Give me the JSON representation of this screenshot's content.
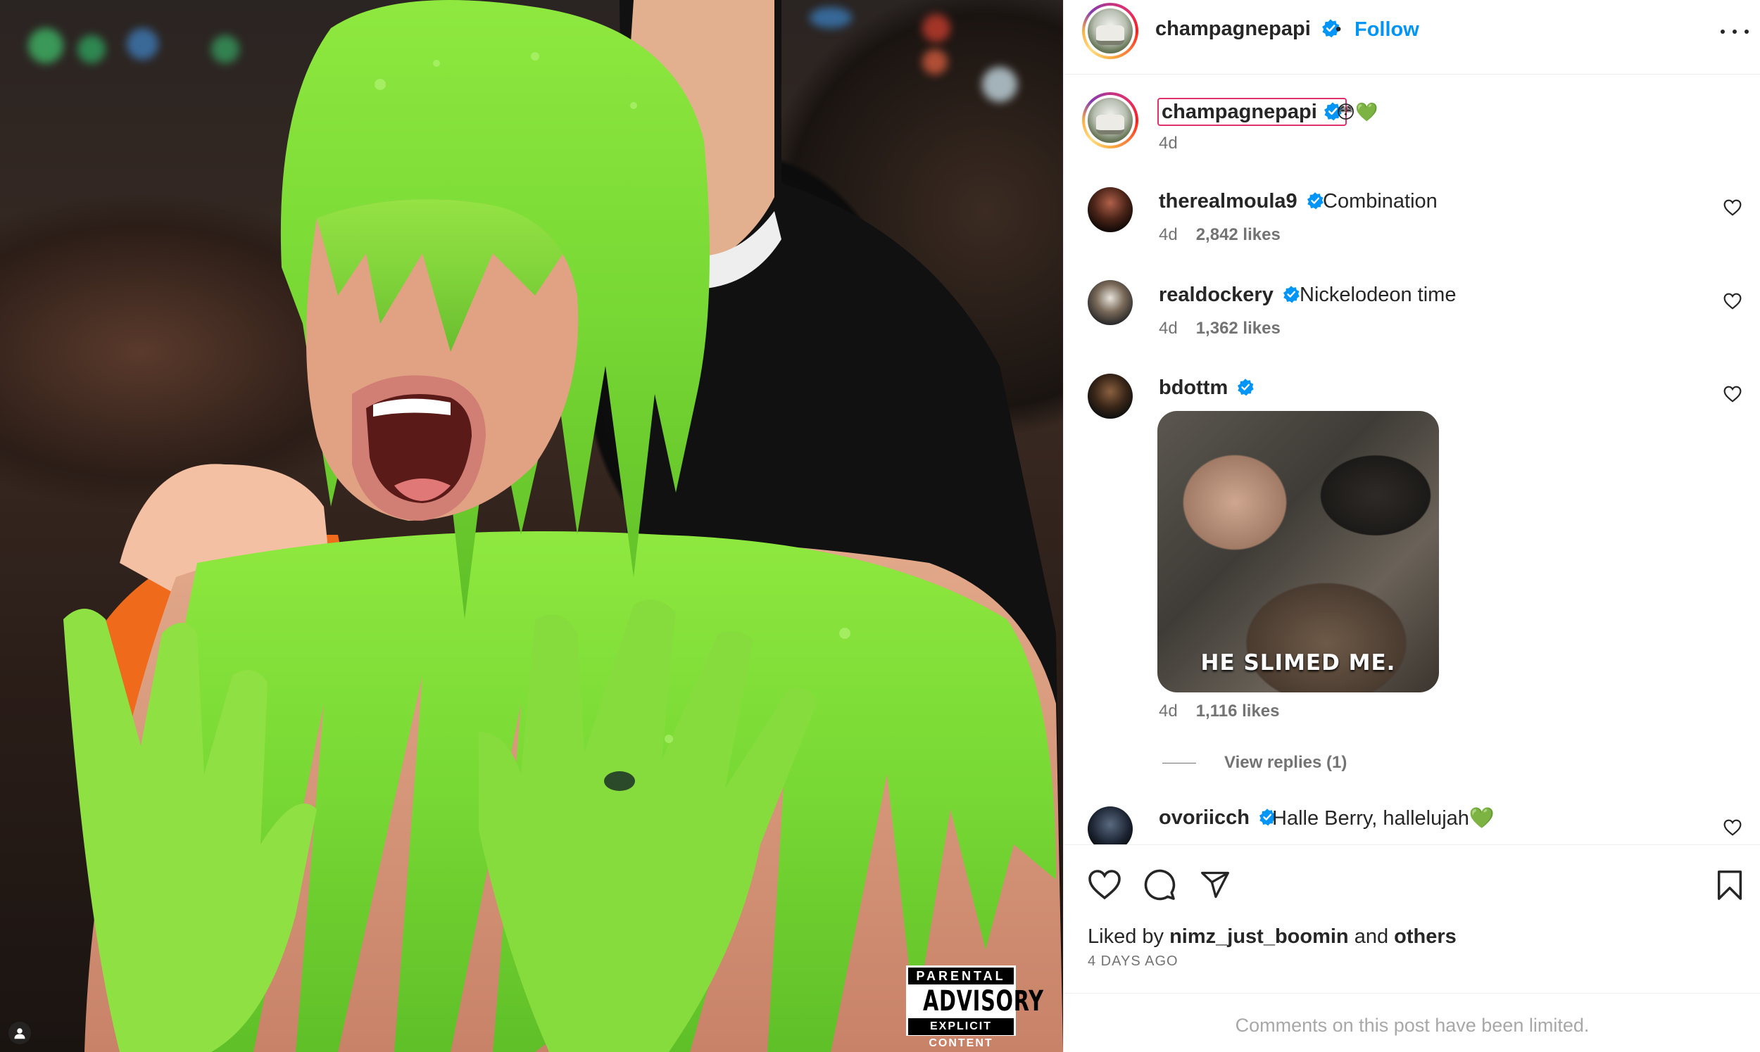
{
  "post": {
    "image_alt": "slimed woman photo",
    "advisory": {
      "top": "PARENTAL",
      "middle": "ADVISORY",
      "bottom": "EXPLICIT CONTENT"
    }
  },
  "header": {
    "username": "champagnepapi",
    "separator": "•",
    "follow_label": "Follow"
  },
  "caption": {
    "username": "champagnepapi",
    "emojis": "😳💚",
    "time": "4d"
  },
  "comments": [
    {
      "username": "therealmoula9",
      "text": "Combination",
      "time": "4d",
      "likes": "2,842 likes"
    },
    {
      "username": "realdockery",
      "text": "Nickelodeon time",
      "time": "4d",
      "likes": "1,362 likes"
    },
    {
      "username": "bdottm",
      "text": "",
      "gif_text": "HE SLIMED ME.",
      "time": "4d",
      "likes": "1,116 likes",
      "view_replies": "View replies (1)"
    },
    {
      "username": "ovoriicch",
      "text": "Halle Berry, hallelujah💚"
    }
  ],
  "footer": {
    "liked_prefix": "Liked by ",
    "liked_user": "nimz_just_boomin",
    "liked_mid": " and ",
    "liked_others": "others",
    "date": "4 DAYS AGO",
    "limited": "Comments on this post have been limited."
  },
  "colors": {
    "accent": "#0095f6",
    "verified": "#0095f6",
    "text": "#262626",
    "muted": "#737373",
    "slime": "#7fe03a"
  },
  "icons": [
    "verified-icon",
    "more-icon",
    "heart-icon",
    "comment-icon",
    "share-icon",
    "bookmark-icon",
    "user-tag-icon"
  ]
}
